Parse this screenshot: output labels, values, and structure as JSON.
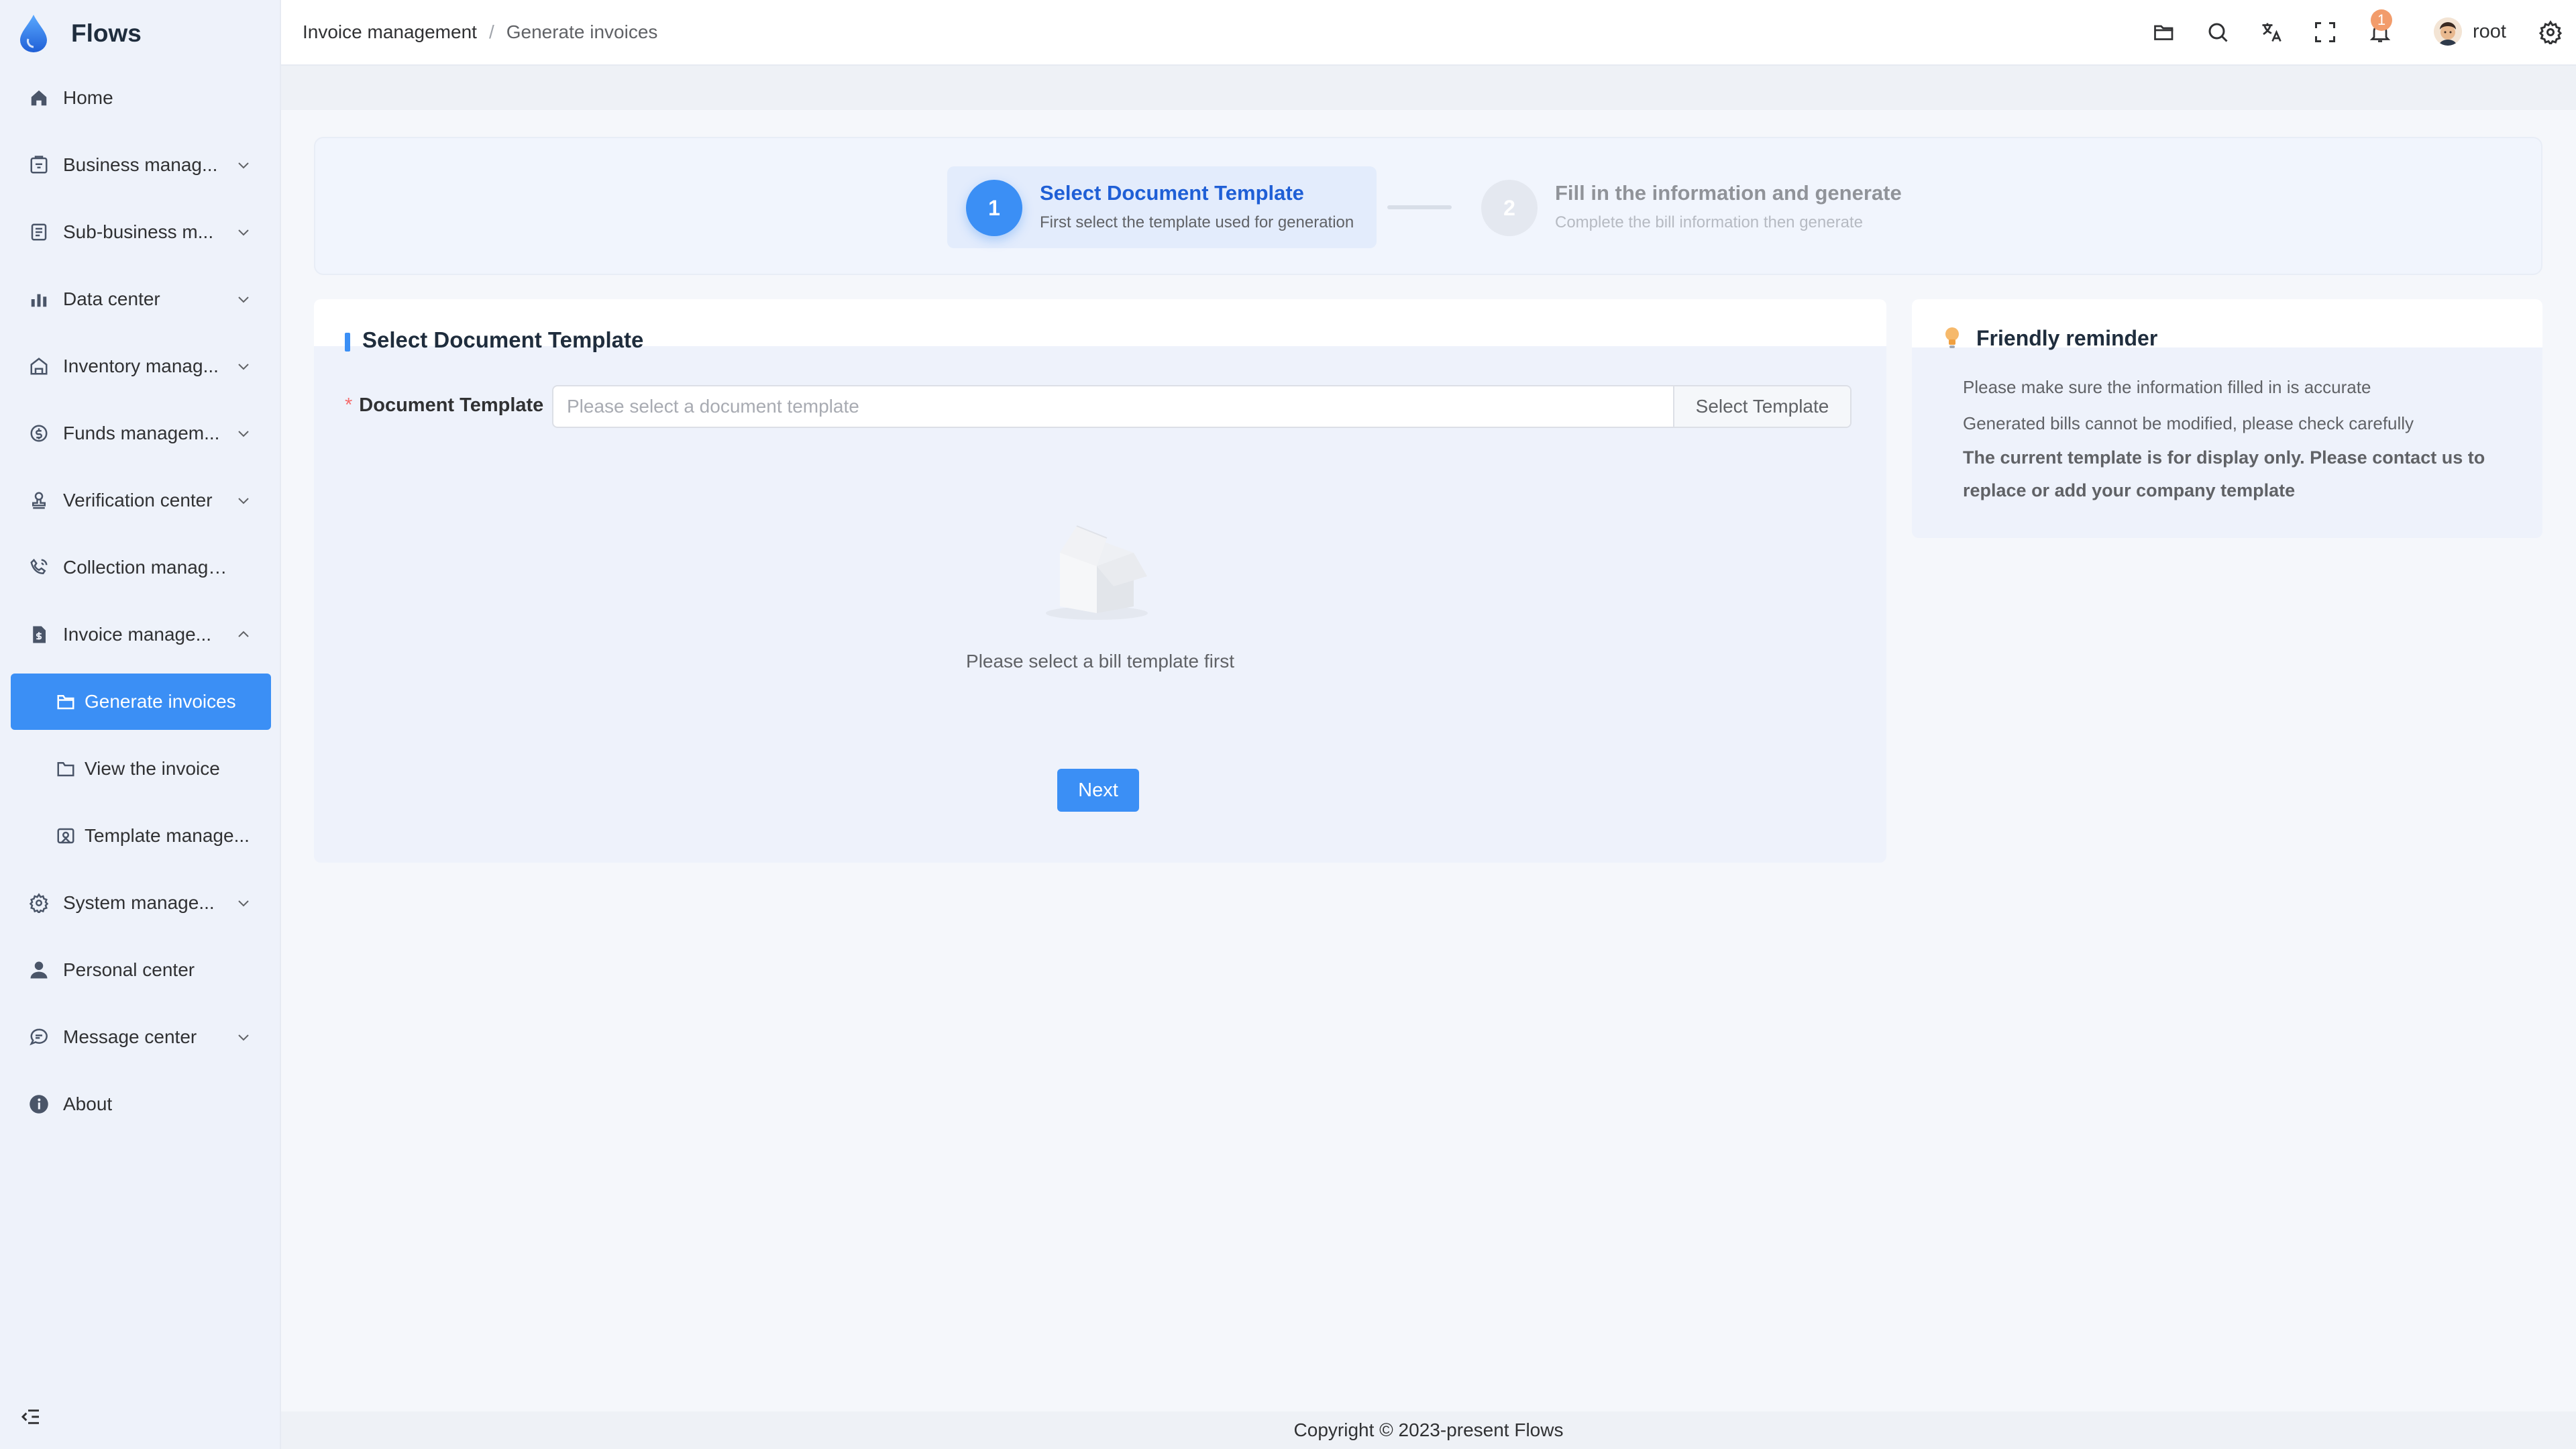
{
  "app": {
    "name": "Flows"
  },
  "sidebar": {
    "items": [
      {
        "label": "Home",
        "icon": "home-icon"
      },
      {
        "label": "Business manag...",
        "icon": "briefcase-icon",
        "expandable": true
      },
      {
        "label": "Sub-business m...",
        "icon": "document-list-icon",
        "expandable": true
      },
      {
        "label": "Data center",
        "icon": "bar-chart-icon",
        "expandable": true
      },
      {
        "label": "Inventory manag...",
        "icon": "warehouse-icon",
        "expandable": true
      },
      {
        "label": "Funds managem...",
        "icon": "coin-icon",
        "expandable": true
      },
      {
        "label": "Verification center",
        "icon": "stamp-icon",
        "expandable": true
      },
      {
        "label": "Collection managem...",
        "icon": "phone-icon"
      },
      {
        "label": "Invoice manage...",
        "icon": "invoice-icon",
        "expandable": true,
        "expanded": true
      },
      {
        "label": "System manage...",
        "icon": "gear-icon",
        "expandable": true
      },
      {
        "label": "Personal center",
        "icon": "user-icon"
      },
      {
        "label": "Message center",
        "icon": "chat-icon",
        "expandable": true
      },
      {
        "label": "About",
        "icon": "info-icon"
      }
    ],
    "subitems": [
      {
        "label": "Generate invoices",
        "icon": "folder-icon",
        "active": true
      },
      {
        "label": "View the invoice",
        "icon": "folder-icon"
      },
      {
        "label": "Template manage...",
        "icon": "image-template-icon"
      }
    ]
  },
  "header": {
    "breadcrumb": [
      "Invoice management",
      "Generate invoices"
    ],
    "notification_count": "1",
    "user": "root"
  },
  "steps": [
    {
      "number": "1",
      "title": "Select Document Template",
      "desc": "First select the template used for generation",
      "active": true
    },
    {
      "number": "2",
      "title": "Fill in the information and generate",
      "desc": "Complete the bill information then generate",
      "active": false
    }
  ],
  "form": {
    "title": "Select Document Template",
    "required_mark": "*",
    "field_label": "Document Template",
    "placeholder": "Please select a document template",
    "value": "",
    "select_button": "Select Template",
    "empty_text": "Please select a bill template first",
    "next_button": "Next"
  },
  "reminder": {
    "title": "Friendly reminder",
    "tips": [
      "Please make sure the information filled in is accurate",
      "Generated bills cannot be modified, please check carefully"
    ],
    "important": "The current template is for display only. Please contact us to replace or add your company template"
  },
  "footer": {
    "copyright": "Copyright © 2023-present Flows"
  },
  "colors": {
    "accent": "#3b8ff5",
    "badge": "#f29c6b",
    "sidebar_bg": "#eef2fa"
  }
}
